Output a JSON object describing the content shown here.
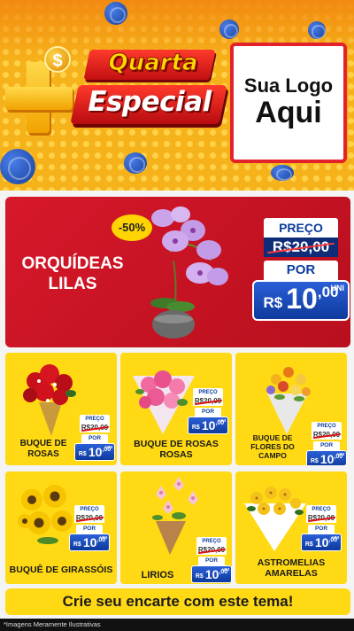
{
  "header": {
    "currency_symbol": "$",
    "title_line1": "Quarta",
    "title_line2": "Especial",
    "logo_line1": "Sua Logo",
    "logo_line2": "Aqui"
  },
  "featured": {
    "name": "ORQUÍDEAS LILAS",
    "discount": "-50%",
    "price": {
      "label_before": "PREÇO",
      "old_price": "R$20,00",
      "label_now": "POR",
      "currency": "R$",
      "new_whole": "10",
      "new_cents": ",00",
      "unit": "UNI"
    }
  },
  "products": [
    {
      "name": "BUQUE DE ROSAS",
      "label_before": "PREÇO",
      "old_price": "R$20,00",
      "label_now": "POR",
      "currency": "R$",
      "new_whole": "10",
      "new_cents": ",00",
      "unit": "UNI"
    },
    {
      "name": "BUQUE DE ROSAS ROSAS",
      "label_before": "PREÇO",
      "old_price": "R$20,00",
      "label_now": "POR",
      "currency": "R$",
      "new_whole": "10",
      "new_cents": ",00",
      "unit": "UNI"
    },
    {
      "name": "BUQUE DE FLORES DO CAMPO",
      "label_before": "PREÇO",
      "old_price": "R$20,00",
      "label_now": "POR",
      "currency": "R$",
      "new_whole": "10",
      "new_cents": ",00",
      "unit": "UNI"
    },
    {
      "name": "BUQUÊ DE GIRASSÓIS",
      "label_before": "PREÇO",
      "old_price": "R$20,00",
      "label_now": "POR",
      "currency": "R$",
      "new_whole": "10",
      "new_cents": ",00",
      "unit": "UNI"
    },
    {
      "name": "LIRIOS",
      "label_before": "PREÇO",
      "old_price": "R$20,00",
      "label_now": "POR",
      "currency": "R$",
      "new_whole": "10",
      "new_cents": ",00",
      "unit": "UNI"
    },
    {
      "name": "ASTROMELIAS AMARELAS",
      "label_before": "PREÇO",
      "old_price": "R$20,00",
      "label_now": "POR",
      "currency": "R$",
      "new_whole": "10",
      "new_cents": ",00",
      "unit": "UNI"
    }
  ],
  "cta": "Crie seu encarte com este tema!",
  "footer": "*Imagens Meramente Ilustrativas",
  "colors": {
    "header_orange": "#f6b21a",
    "banner_red": "#d6182a",
    "card_yellow": "#ffd914",
    "price_blue": "#0e3a9c"
  },
  "icons": [
    "dollar-coin-icon",
    "plus-sign-icon",
    "blue-coin-icon"
  ]
}
